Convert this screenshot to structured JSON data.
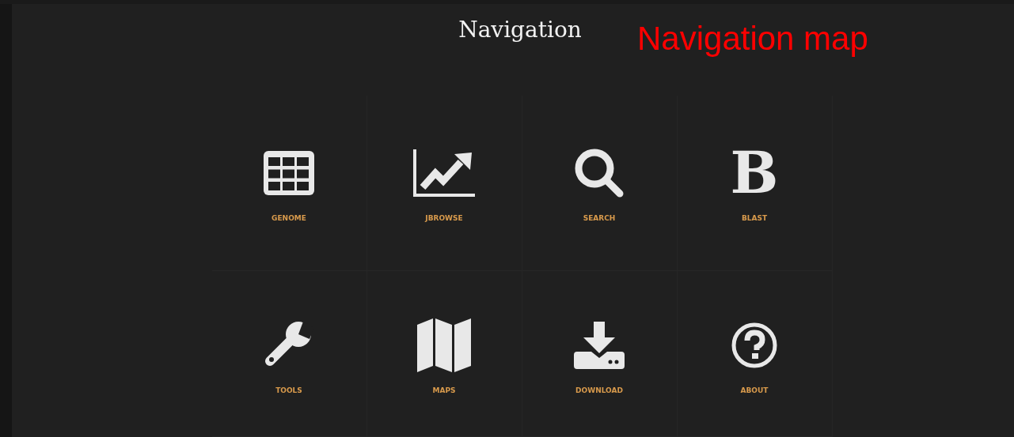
{
  "header": {
    "title": "Navigation",
    "annotation": "Navigation map"
  },
  "tiles": [
    {
      "kind": "table",
      "label": "GENOME"
    },
    {
      "kind": "chart",
      "label": "JBROWSE"
    },
    {
      "kind": "search",
      "label": "SEARCH"
    },
    {
      "kind": "letter",
      "glyph": "B",
      "label": "BLAST"
    },
    {
      "kind": "wrench",
      "label": "TOOLS"
    },
    {
      "kind": "map",
      "label": "MAPS"
    },
    {
      "kind": "download",
      "label": "DOWNLOAD"
    },
    {
      "kind": "help",
      "label": "ABOUT"
    }
  ]
}
